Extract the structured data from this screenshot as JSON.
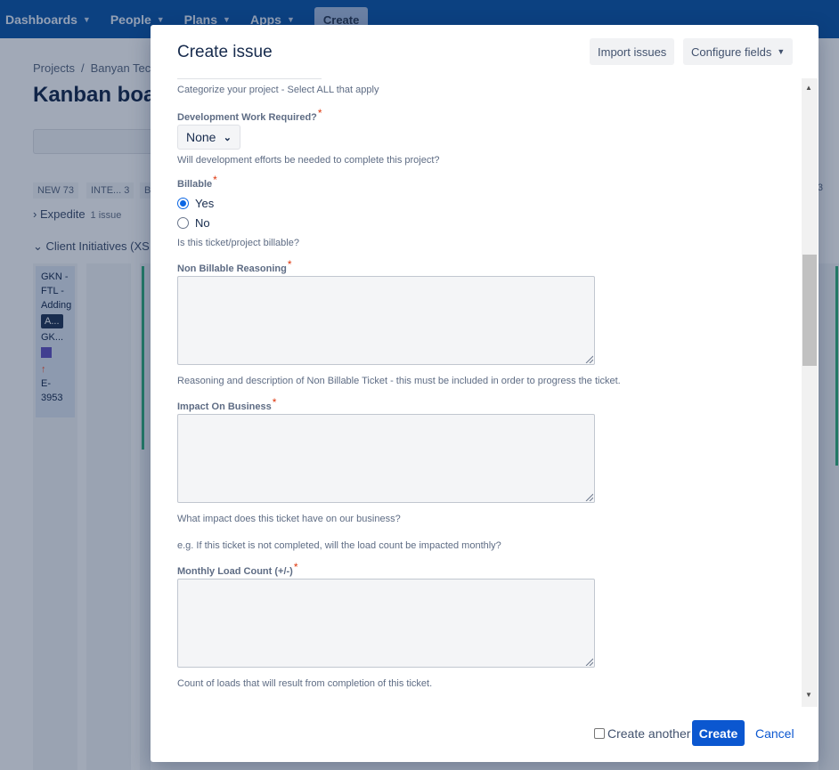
{
  "topnav": {
    "items": [
      {
        "label": "Dashboards"
      },
      {
        "label": "People"
      },
      {
        "label": "Plans"
      },
      {
        "label": "Apps"
      }
    ],
    "create_label": "Create"
  },
  "background": {
    "breadcrumb": {
      "projects": "Projects",
      "separator": "/",
      "project": "Banyan Tec"
    },
    "board_title": "Kanban boar",
    "columns": [
      {
        "label": "NEW 73"
      },
      {
        "label": "INTE... 3"
      },
      {
        "label": "B"
      }
    ],
    "column_right_count": "3",
    "swimlanes": [
      {
        "label": "Expedite",
        "count": "1 issue"
      },
      {
        "label": "Client Initiatives (XS,",
        "count": ""
      }
    ],
    "card": {
      "title_lines": [
        "GKN -",
        "FTL -",
        "Adding"
      ],
      "tag": "A...",
      "key_short": "GK...",
      "issue_key": "E-3953"
    }
  },
  "modal": {
    "title": "Create issue",
    "import_label": "Import issues",
    "configure_label": "Configure fields",
    "categorize_help": "Categorize your project - Select ALL that apply",
    "fields": {
      "dev_work": {
        "label": "Development Work Required?",
        "value": "None",
        "help": "Will development efforts be needed to complete this project?"
      },
      "billable": {
        "label": "Billable",
        "options": [
          "Yes",
          "No"
        ],
        "selected": "Yes",
        "help": "Is this ticket/project billable?"
      },
      "non_billable": {
        "label": "Non Billable Reasoning",
        "value": "",
        "help": "Reasoning and description of Non Billable Ticket - this must be included in order to progress the ticket."
      },
      "impact": {
        "label": "Impact On Business",
        "value": "",
        "help": "What impact does this ticket have on our business?",
        "help2": "e.g. If this ticket is not completed, will the load count be impacted monthly?"
      },
      "load_count": {
        "label": "Monthly Load Count (+/-)",
        "value": "",
        "help": "Count of loads that will result from completion of this ticket."
      }
    },
    "required_marker": "*",
    "footer": {
      "create_another_label": "Create another",
      "create_another_checked": false,
      "create_label": "Create",
      "cancel_label": "Cancel"
    }
  },
  "colors": {
    "nav": "#0f57a8",
    "primary": "#0b57d0",
    "required": "#de350b"
  }
}
